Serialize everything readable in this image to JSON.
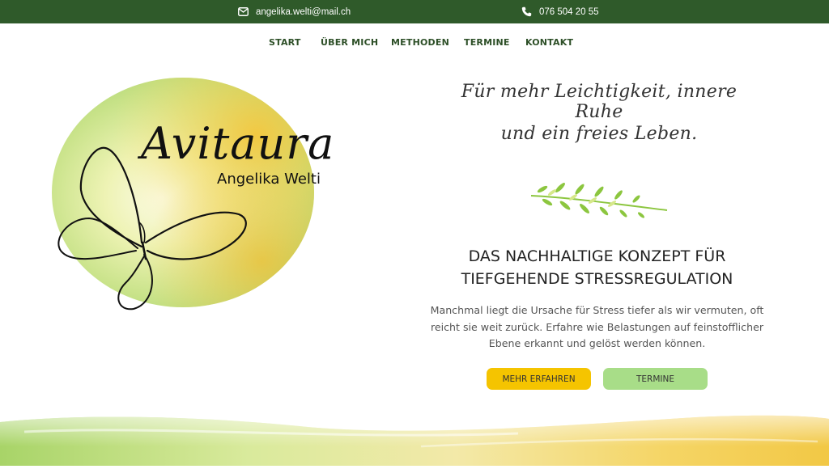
{
  "topbar": {
    "email": "angelika.welti@mail.ch",
    "phone": "076 504 20 55",
    "email_icon": "envelope-icon",
    "phone_icon": "phone-icon"
  },
  "nav": {
    "items": [
      {
        "label": "START"
      },
      {
        "label": "ÜBER MICH"
      },
      {
        "label": "METHODEN"
      },
      {
        "label": "TERMINE"
      },
      {
        "label": "KONTAKT"
      }
    ]
  },
  "logo": {
    "brand": "Avitaura",
    "name": "Angelika Welti"
  },
  "hero": {
    "tagline_line1": "Für mehr Leichtigkeit, innere Ruhe",
    "tagline_line2": "und ein freies Leben.",
    "headline_line1": "DAS NACHHALTIGE KONZEPT FÜR",
    "headline_line2": "TIEFGEHENDE STRESSREGULATION",
    "description": "Manchmal liegt die Ursache für Stress tiefer als wir vermuten, oft reicht sie weit zurück. Erfahre wie Belastungen auf feinstofflicher Ebene erkannt und gelöst werden können.",
    "button_primary": "MEHR ERFAHREN",
    "button_secondary": "TERMINE"
  },
  "colors": {
    "topbar": "#2f5a2a",
    "nav_text": "#2d4f27",
    "button_primary": "#f5c400",
    "button_secondary": "#a8dd88"
  }
}
